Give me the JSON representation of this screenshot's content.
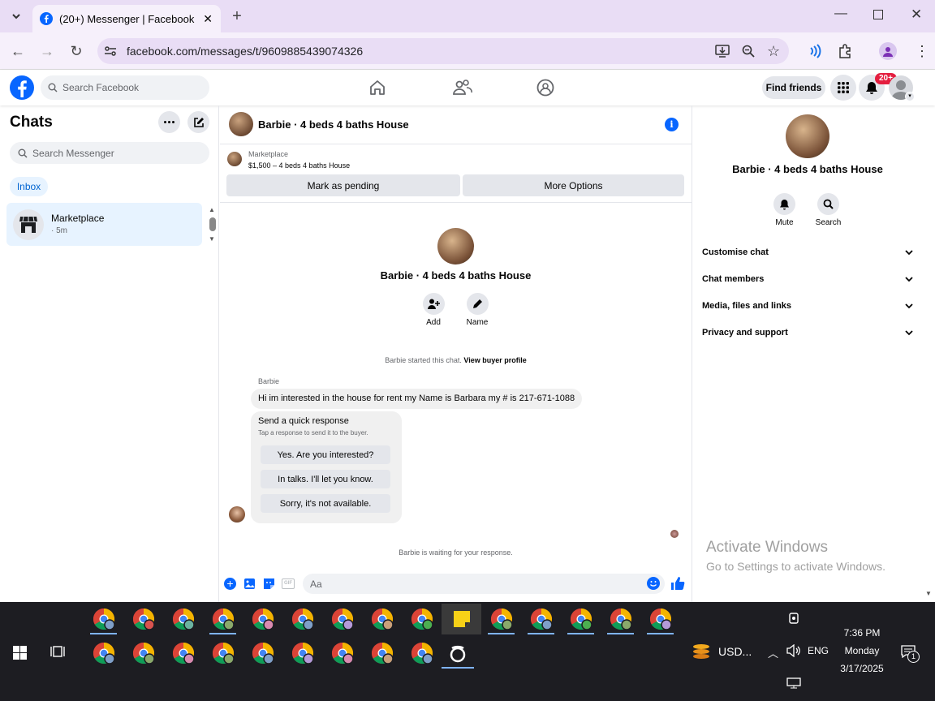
{
  "browser": {
    "tab_title": "(20+) Messenger | Facebook",
    "url": "facebook.com/messages/t/9609885439074326"
  },
  "fb": {
    "search_placeholder": "Search Facebook",
    "find_friends": "Find friends",
    "notif_badge": "20+",
    "brand_color": "#0866ff"
  },
  "left": {
    "title": "Chats",
    "search_placeholder": "Search Messenger",
    "inbox_label": "Inbox",
    "chat": {
      "name": "Marketplace",
      "time": "· 5m"
    }
  },
  "center": {
    "header_title": "Barbie · 4 beds 4 baths House",
    "mp_label": "Marketplace",
    "mp_listing": "$1,500 – 4 beds 4 baths House",
    "mark_pending": "Mark as pending",
    "more_options": "More Options",
    "profile_name": "Barbie · 4 beds 4 baths House",
    "add_label": "Add",
    "name_label": "Name",
    "started_text": "Barbie started this chat.",
    "view_buyer": "View buyer profile",
    "sender": "Barbie",
    "message": "Hi im interested in the house for rent my Name is Barbara my # is 217-671-1088",
    "quick_title": "Send a quick response",
    "quick_sub": "Tap a response to send it to the buyer.",
    "quick_replies": [
      "Yes. Are you interested?",
      "In talks. I'll let you know.",
      "Sorry, it's not available."
    ],
    "waiting": "Barbie is waiting for your response.",
    "composer_placeholder": "Aa",
    "gif": "GIF"
  },
  "right": {
    "name": "Barbie · 4 beds 4 baths House",
    "mute": "Mute",
    "search": "Search",
    "sections": [
      "Customise chat",
      "Chat members",
      "Media, files and links",
      "Privacy and support"
    ],
    "activate_title": "Activate Windows",
    "activate_sub": "Go to Settings to activate Windows."
  },
  "taskbar": {
    "time": "7:36 PM",
    "day": "Monday",
    "date": "3/17/2025",
    "lang": "ENG",
    "ticker": "USD...",
    "notif_count": "1"
  }
}
